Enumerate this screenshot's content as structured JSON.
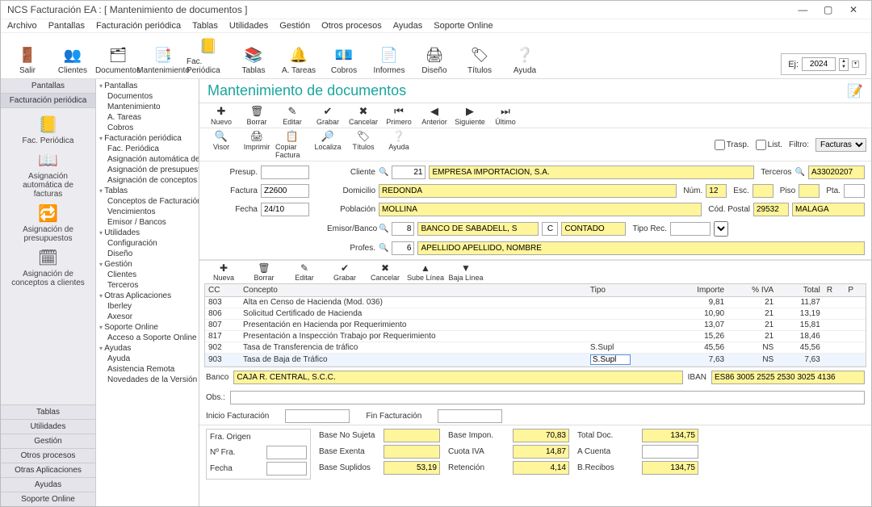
{
  "window": {
    "title": "NCS Facturación EA : [ Mantenimiento de documentos ]"
  },
  "menubar": [
    "Archivo",
    "Pantallas",
    "Facturación periódica",
    "Tablas",
    "Utilidades",
    "Gestión",
    "Otros procesos",
    "Ayudas",
    "Soporte Online"
  ],
  "toolbar": [
    {
      "label": "Salir",
      "icon": "🚪"
    },
    {
      "label": "Clientes",
      "icon": "👥"
    },
    {
      "label": "Documentos",
      "icon": "🗂"
    },
    {
      "label": "Mantenimiento",
      "icon": "📑"
    },
    {
      "label": "Fac. Periódica",
      "icon": "📒"
    },
    {
      "label": "Tablas",
      "icon": "📚"
    },
    {
      "label": "A. Tareas",
      "icon": "🔔"
    },
    {
      "label": "Cobros",
      "icon": "💶"
    },
    {
      "label": "Informes",
      "icon": "📄"
    },
    {
      "label": "Diseño",
      "icon": "🖨"
    },
    {
      "label": "Títulos",
      "icon": "🏷"
    },
    {
      "label": "Ayuda",
      "icon": "❔"
    }
  ],
  "ej": {
    "label": "Ej:",
    "value": "2024"
  },
  "leftnav": {
    "top": [
      "Pantallas",
      "Facturación periódica"
    ],
    "panel": [
      {
        "label": "Fac. Periódica",
        "icon": "📒"
      },
      {
        "label": "Asignación automática de facturas",
        "icon": "📖"
      },
      {
        "label": "Asignación de presupuestos",
        "icon": "🔁"
      },
      {
        "label": "Asignación de conceptos a clientes",
        "icon": "🗓"
      }
    ],
    "bottom": [
      "Tablas",
      "Utilidades",
      "Gestión",
      "Otros procesos",
      "Otras Aplicaciones",
      "Ayudas",
      "Soporte Online"
    ]
  },
  "tree": [
    {
      "label": "Pantallas",
      "children": [
        "Documentos",
        "Mantenimiento",
        "A. Tareas",
        "Cobros"
      ]
    },
    {
      "label": "Facturación periódica",
      "children": [
        "Fac. Periódica",
        "Asignación automática de fa",
        "Asignación de presupuesto",
        "Asignación de conceptos a"
      ]
    },
    {
      "label": "Tablas",
      "children": [
        "Conceptos de Facturación",
        "Vencimientos",
        "Emisor / Bancos"
      ]
    },
    {
      "label": "Utilidades",
      "children": [
        "Configuración",
        "Diseño"
      ]
    },
    {
      "label": "Gestión",
      "children": [
        "Clientes",
        "Terceros"
      ]
    },
    {
      "label": "Otras Aplicaciones",
      "children": [
        "Iberley",
        "Axesor"
      ]
    },
    {
      "label": "Soporte Online",
      "children": [
        "Acceso a Soporte Online"
      ]
    },
    {
      "label": "Ayudas",
      "children": [
        "Ayuda",
        "Asistencia Remota",
        "Novedades de la Versión"
      ]
    }
  ],
  "main_title": "Mantenimiento de documentos",
  "actions1": [
    {
      "label": "Nuevo",
      "icon": "✚"
    },
    {
      "label": "Borrar",
      "icon": "🗑"
    },
    {
      "label": "Editar",
      "icon": "✎"
    },
    {
      "label": "Grabar",
      "icon": "✔"
    },
    {
      "label": "Cancelar",
      "icon": "✖"
    },
    {
      "label": "Primero",
      "icon": "⏮"
    },
    {
      "label": "Anterior",
      "icon": "◀"
    },
    {
      "label": "Siguiente",
      "icon": "▶"
    },
    {
      "label": "Último",
      "icon": "⏭"
    }
  ],
  "actions2": [
    {
      "label": "Visor",
      "icon": "🔍"
    },
    {
      "label": "Imprimir",
      "icon": "🖨"
    },
    {
      "label": "Copiar Factura",
      "icon": "📋"
    },
    {
      "label": "Localiza",
      "icon": "🔎"
    },
    {
      "label": "Títulos",
      "icon": "🏷"
    },
    {
      "label": "Ayuda",
      "icon": "❔"
    }
  ],
  "filters": {
    "trasp": "Trasp.",
    "list": "List.",
    "filtro_lbl": "Filtro:",
    "filtro_val": "Facturas"
  },
  "form_left": [
    {
      "label": "Presup.",
      "value": ""
    },
    {
      "label": "Factura",
      "value": "Z2600"
    },
    {
      "label": "Fecha",
      "value": "24/10"
    }
  ],
  "cliente": {
    "cliente_lbl": "Cliente",
    "cliente_code": "21",
    "cliente_name": "EMPRESA IMPORTACION, S.A.",
    "terceros_lbl": "Terceros",
    "terceros_val": "A33020207",
    "domicilio_lbl": "Domicilio",
    "domicilio": "REDONDA",
    "num_lbl": "Núm.",
    "num": "12",
    "esc_lbl": "Esc.",
    "piso_lbl": "Piso",
    "pta_lbl": "Pta.",
    "poblacion_lbl": "Población",
    "poblacion": "MOLLINA",
    "cp_lbl": "Cód. Postal",
    "cp": "29532",
    "provincia": "MALAGA",
    "emisor_lbl": "Emisor/Banco",
    "emisor_code": "8",
    "emisor_name": "BANCO DE SABADELL, S",
    "blank_code": "C",
    "contado": "CONTADO",
    "tiporec_lbl": "Tipo Rec.",
    "profes_lbl": "Profes.",
    "profes_code": "6",
    "profes_name": "APELLIDO APELLIDO, NOMBRE"
  },
  "lines_tb": [
    {
      "label": "Nueva",
      "icon": "✚"
    },
    {
      "label": "Borrar",
      "icon": "🗑"
    },
    {
      "label": "Editar",
      "icon": "✎"
    },
    {
      "label": "Grabar",
      "icon": "✔"
    },
    {
      "label": "Cancelar",
      "icon": "✖"
    },
    {
      "label": "Sube Línea",
      "icon": "▲"
    },
    {
      "label": "Baja Línea",
      "icon": "▼"
    }
  ],
  "grid": {
    "headers": [
      "CC",
      "Concepto",
      "Tipo",
      "Importe",
      "% IVA",
      "Total",
      "R",
      "P"
    ],
    "rows": [
      {
        "cc": "803",
        "concepto": "Alta en Censo de Hacienda (Mod. 036)",
        "tipo": "",
        "importe": "9,81",
        "iva": "21",
        "total": "11,87",
        "r": "",
        "p": ""
      },
      {
        "cc": "806",
        "concepto": "Solicitud Certificado de Hacienda",
        "tipo": "",
        "importe": "10,90",
        "iva": "21",
        "total": "13,19",
        "r": "",
        "p": ""
      },
      {
        "cc": "807",
        "concepto": "Presentación en Hacienda por Requerimiento",
        "tipo": "",
        "importe": "13,07",
        "iva": "21",
        "total": "15,81",
        "r": "",
        "p": ""
      },
      {
        "cc": "817",
        "concepto": "Presentación a Inspección Trabajo por Requerimiento",
        "tipo": "",
        "importe": "15,26",
        "iva": "21",
        "total": "18,46",
        "r": "",
        "p": ""
      },
      {
        "cc": "902",
        "concepto": "Tasa de Transferencia de tráfico",
        "tipo": "S.Supl",
        "importe": "45,56",
        "iva": "NS",
        "total": "45,56",
        "r": "",
        "p": ""
      },
      {
        "cc": "903",
        "concepto": "Tasa de Baja de Tráfico",
        "tipo": "S.Supl",
        "importe": "7,63",
        "iva": "NS",
        "total": "7,63",
        "r": "",
        "p": "",
        "sel": true
      }
    ]
  },
  "bank": {
    "banco_lbl": "Banco",
    "banco": "CAJA R. CENTRAL, S.C.C.",
    "iban_lbl": "IBAN",
    "iban": "ES86 3005 2525 2530 3025 4136",
    "obs_lbl": "Obs.:",
    "obs": ""
  },
  "fact": {
    "inicio_lbl": "Inicio Facturación",
    "inicio": "",
    "fin_lbl": "Fin Facturación",
    "fin": ""
  },
  "totals": {
    "fra_origen_lbl": "Fra. Origen",
    "nfra_lbl": "Nº Fra.",
    "nfra": "",
    "fecha_lbl": "Fecha",
    "fecha": "",
    "base_nosujeta_lbl": "Base No Sujeta",
    "base_nosujeta": "",
    "base_exenta_lbl": "Base Exenta",
    "base_exenta": "",
    "base_suplidos_lbl": "Base Suplidos",
    "base_suplidos": "53,19",
    "base_impon_lbl": "Base Impon.",
    "base_impon": "70,83",
    "cuota_iva_lbl": "Cuota IVA",
    "cuota_iva": "14,87",
    "retencion_lbl": "Retención",
    "retencion": "4,14",
    "total_doc_lbl": "Total Doc.",
    "total_doc": "134,75",
    "a_cuenta_lbl": "A Cuenta",
    "a_cuenta": "",
    "b_recibos_lbl": "B.Recibos",
    "b_recibos": "134,75"
  }
}
